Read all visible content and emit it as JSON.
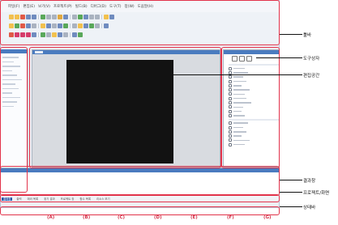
{
  "menu": [
    "파일(F)",
    "편집(E)",
    "보기(V)",
    "프로젝트(P)",
    "빌드(B)",
    "디버그(D)",
    "도구(T)",
    "창(W)",
    "도움말(H)"
  ],
  "toolbar_colors": {
    "row1": [
      "#f2c14e",
      "#f2c14e",
      "#e05a47",
      "#6f8bbf",
      "#6f8bbf",
      "#59a85a",
      "#a9b2c0",
      "#a9b2c0",
      "#e0a840",
      "#6f8bbf",
      "#a9b2c0",
      "#59a85a",
      "#6f8bbf",
      "#a9b2c0",
      "#a9b2c0",
      "#f2c14e",
      "#6f8bbf"
    ],
    "row2": [
      "#f2c14e",
      "#59a85a",
      "#e05a47",
      "#6f8bbf",
      "#a9b2c0",
      "#f2c14e",
      "#6f8bbf",
      "#a9b2c0",
      "#6f8bbf",
      "#59a85a",
      "#a9b2c0",
      "#f2c14e",
      "#6f8bbf",
      "#59a85a",
      "#a9b2c0",
      "#6f8bbf"
    ],
    "row3": [
      "#e05a47",
      "#d63c6b",
      "#d63c6b",
      "#d63c6b",
      "#6f8bbf",
      "#59a85a",
      "#a9b2c0",
      "#f2c14e",
      "#6f8bbf",
      "#a9b2c0",
      "#6f8bbf",
      "#59a85a"
    ]
  },
  "result_tabs": [
    "결과창",
    "출력",
    "에러 목록",
    "찾기 결과",
    "프로젝트 창",
    "함수 목록",
    "리소스 보기"
  ],
  "status_segments": [
    "",
    "",
    "",
    "",
    "",
    "",
    "",
    ""
  ],
  "letters": [
    "(A)",
    "(B)",
    "(C)",
    "(D)",
    "(E)",
    "(F)",
    "(G)"
  ],
  "callouts": {
    "menu": "툴바",
    "toolbox": "도구상자",
    "editor": "편집공간",
    "result": "결과창",
    "project": "프로젝트/화면",
    "status": "상태바"
  },
  "colors": {
    "highlight": "#e2334b",
    "statusbar": "#2d5ea8",
    "panel_header": "#4a7bbf",
    "canvas": "#121212"
  }
}
